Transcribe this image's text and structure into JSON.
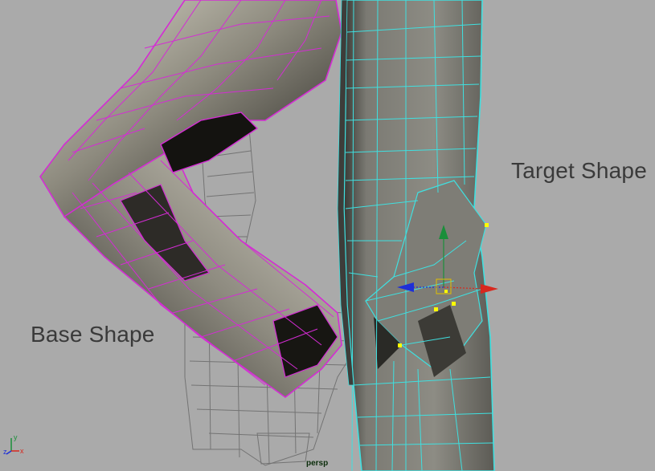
{
  "viewport": {
    "camera_label": "persp",
    "annotations": {
      "target_shape": "Target Shape",
      "base_shape": "Base Shape"
    }
  },
  "axis_indicator": {
    "y_label": "y",
    "z_label": "z",
    "x_label": "x"
  },
  "colors": {
    "background": "#aaaaaa",
    "base_wire": "#d42cd4",
    "target_wire": "#3fe0e0",
    "ghost_wire": "#6e6e6e",
    "manip_x": "#d8281e",
    "manip_y": "#1a8f3a",
    "manip_z": "#1e2fd8",
    "selected_vertex": "#ffff00"
  },
  "icons": {
    "manipulator": "move-manipulator-icon",
    "axis": "view-axis-icon"
  }
}
